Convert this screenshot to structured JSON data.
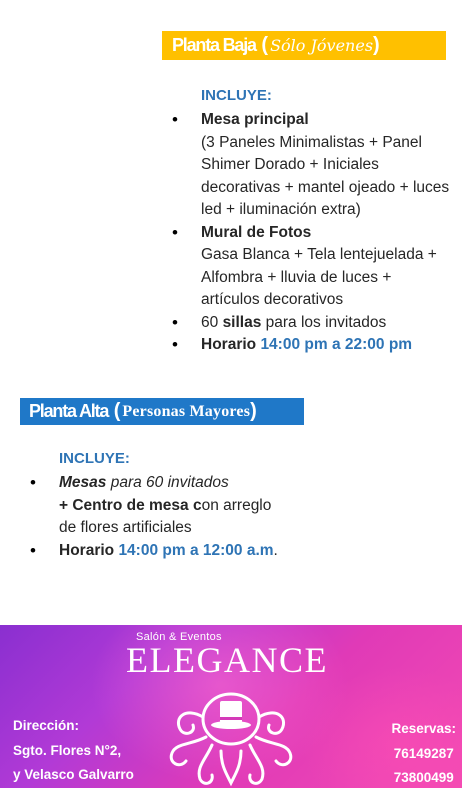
{
  "planta_baja": {
    "title": "Planta Baja",
    "subtitle": "Sólo Jóvenes",
    "includes_label": "INCLUYE:",
    "items": [
      {
        "name": "Mesa principal",
        "desc": "(3 Paneles Minimalistas + Panel Shimer Dorado + Iniciales decorativas + mantel ojeado + luces led + iluminación extra)"
      },
      {
        "name": "Mural de Fotos",
        "desc": "Gasa Blanca + Tela lentejuelada + Alfombra + lluvia de luces + artículos decorativos"
      }
    ],
    "sillas": {
      "count": "60",
      "bold": "sillas",
      "rest": "para los invitados"
    },
    "horario": {
      "label": "Horario",
      "value": "14:00 pm a 22:00 pm"
    }
  },
  "planta_alta": {
    "title": "Planta Alta",
    "subtitle": "Personas Mayores",
    "includes_label": "INCLUYE:",
    "mesas": {
      "bold": "Mesas",
      "rest": "para 60 invitados",
      "centro_plus": "+ Centro de mesa c",
      "centro_rest": "on arreglo",
      "line3": "de flores artificiales"
    },
    "horario": {
      "label": "Horario",
      "value": "14:00 pm a 12:00 a.m",
      "end": "."
    }
  },
  "footer": {
    "brand_sub": "Salón & Eventos",
    "brand": "ELEGANCE",
    "address_label": "Dirección:",
    "address_line1": "Sgto. Flores N°2,",
    "address_line2": "y Velasco Galvarro",
    "reservas_label": "Reservas:",
    "phones": [
      "76149287",
      "73800499"
    ],
    "colors": {
      "left": "#8a2fd0",
      "right": "#f44bb3"
    }
  }
}
